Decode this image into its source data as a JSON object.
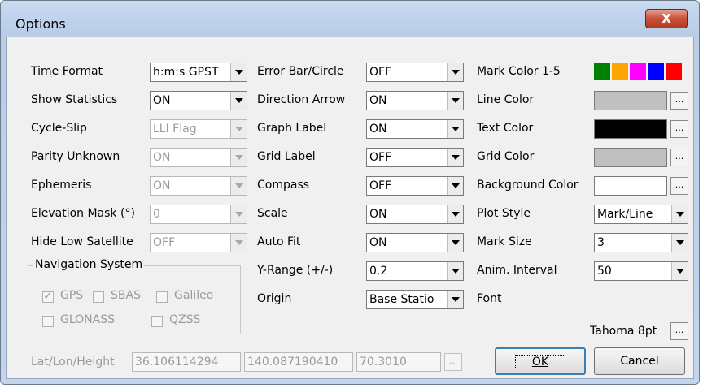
{
  "window": {
    "title": "Options",
    "close_glyph": "X"
  },
  "col1": {
    "time_format": {
      "label": "Time Format",
      "value": "h:m:s GPST"
    },
    "show_statistics": {
      "label": "Show Statistics",
      "value": "ON"
    },
    "cycle_slip": {
      "label": "Cycle-Slip",
      "value": "LLI Flag"
    },
    "parity_unknown": {
      "label": "Parity Unknown",
      "value": "ON"
    },
    "ephemeris": {
      "label": "Ephemeris",
      "value": "ON"
    },
    "elevation_mask": {
      "label": "Elevation Mask (°)",
      "value": "0"
    },
    "hide_low_satellite": {
      "label": "Hide Low Satellite",
      "value": "OFF"
    }
  },
  "col2": {
    "error_bar": {
      "label": "Error Bar/Circle",
      "value": "OFF"
    },
    "direction_arrow": {
      "label": "Direction Arrow",
      "value": "ON"
    },
    "graph_label": {
      "label": "Graph Label",
      "value": "ON"
    },
    "grid_label": {
      "label": "Grid Label",
      "value": "OFF"
    },
    "compass": {
      "label": "Compass",
      "value": "OFF"
    },
    "scale": {
      "label": "Scale",
      "value": "ON"
    },
    "auto_fit": {
      "label": "Auto Fit",
      "value": "ON"
    },
    "y_range": {
      "label": "Y-Range (+/-)",
      "value": "0.2"
    },
    "origin": {
      "label": "Origin",
      "value": "Base Statio"
    }
  },
  "col3": {
    "mark_color": {
      "label": "Mark Color 1-5",
      "colors": [
        "#008000",
        "#ffa500",
        "#ff00ff",
        "#0000ff",
        "#ff0000"
      ]
    },
    "line_color": {
      "label": "Line Color",
      "color": "#c0c0c0"
    },
    "text_color": {
      "label": "Text Color",
      "color": "#000000"
    },
    "grid_color": {
      "label": "Grid Color",
      "color": "#c0c0c0"
    },
    "background_color": {
      "label": "Background Color",
      "color": "#ffffff"
    },
    "plot_style": {
      "label": "Plot Style",
      "value": "Mark/Line"
    },
    "mark_size": {
      "label": "Mark Size",
      "value": "3"
    },
    "anim_interval": {
      "label": "Anim. Interval",
      "value": "50"
    },
    "font": {
      "label": "Font",
      "value": "Tahoma 8pt"
    }
  },
  "dots_label": "...",
  "navigation": {
    "title": "Navigation System",
    "gps": {
      "label": "GPS",
      "checked": true
    },
    "sbas": {
      "label": "SBAS",
      "checked": false
    },
    "galileo": {
      "label": "Galileo",
      "checked": false
    },
    "glonass": {
      "label": "GLONASS",
      "checked": false
    },
    "qzss": {
      "label": "QZSS",
      "checked": false
    }
  },
  "position": {
    "label": "Lat/Lon/Height",
    "lat": "36.106114294",
    "lon": "140.087190410",
    "height": "70.3010"
  },
  "buttons": {
    "ok": "OK",
    "cancel": "Cancel"
  }
}
